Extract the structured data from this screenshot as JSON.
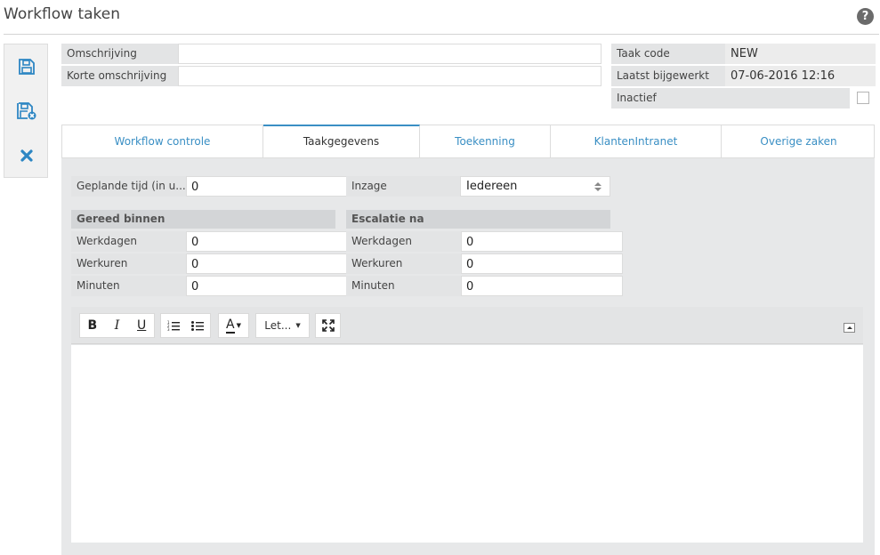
{
  "page": {
    "title": "Workflow taken",
    "help_icon": "question-circle-icon"
  },
  "toolbar": {
    "buttons": [
      {
        "name": "save",
        "icon": "floppy-disk-icon"
      },
      {
        "name": "save-and-close",
        "icon": "floppy-disk-close-icon"
      },
      {
        "name": "cancel",
        "icon": "close-x-icon"
      }
    ]
  },
  "header_form": {
    "omschrijving": {
      "label": "Omschrijving",
      "value": ""
    },
    "korte_omschrijving": {
      "label": "Korte omschrijving",
      "value": ""
    },
    "taak_code": {
      "label": "Taak code",
      "value": "NEW"
    },
    "laatst_bijgewerkt": {
      "label": "Laatst bijgewerkt",
      "value": "07-06-2016 12:16"
    },
    "inactief": {
      "label": "Inactief",
      "checked": false
    }
  },
  "tabs": [
    {
      "label": "Workflow controle",
      "active": false
    },
    {
      "label": "Taakgegevens",
      "active": true
    },
    {
      "label": "Toekenning",
      "active": false
    },
    {
      "label": "KlantenIntranet",
      "active": false
    },
    {
      "label": "Overige zaken",
      "active": false
    }
  ],
  "taakgegevens": {
    "geplande_tijd": {
      "label": "Geplande tijd (in u...",
      "value": "0"
    },
    "inzage": {
      "label": "Inzage",
      "value": "Iedereen"
    },
    "gereed_binnen": {
      "heading": "Gereed binnen",
      "werkdagen": {
        "label": "Werkdagen",
        "value": "0"
      },
      "werkuren": {
        "label": "Werkuren",
        "value": "0"
      },
      "minuten": {
        "label": "Minuten",
        "value": "0"
      }
    },
    "escalatie_na": {
      "heading": "Escalatie na",
      "werkdagen": {
        "label": "Werkdagen",
        "value": "0"
      },
      "werkuren": {
        "label": "Werkuren",
        "value": "0"
      },
      "minuten": {
        "label": "Minuten",
        "value": "0"
      }
    }
  },
  "editor": {
    "bold": "B",
    "italic": "I",
    "underline": "U",
    "font_color": "A",
    "font_name": "Let...",
    "content": ""
  },
  "colors": {
    "accent": "#3a8fc4",
    "panel_bg": "#e7e8e9",
    "label_bg": "#e3e4e5"
  }
}
